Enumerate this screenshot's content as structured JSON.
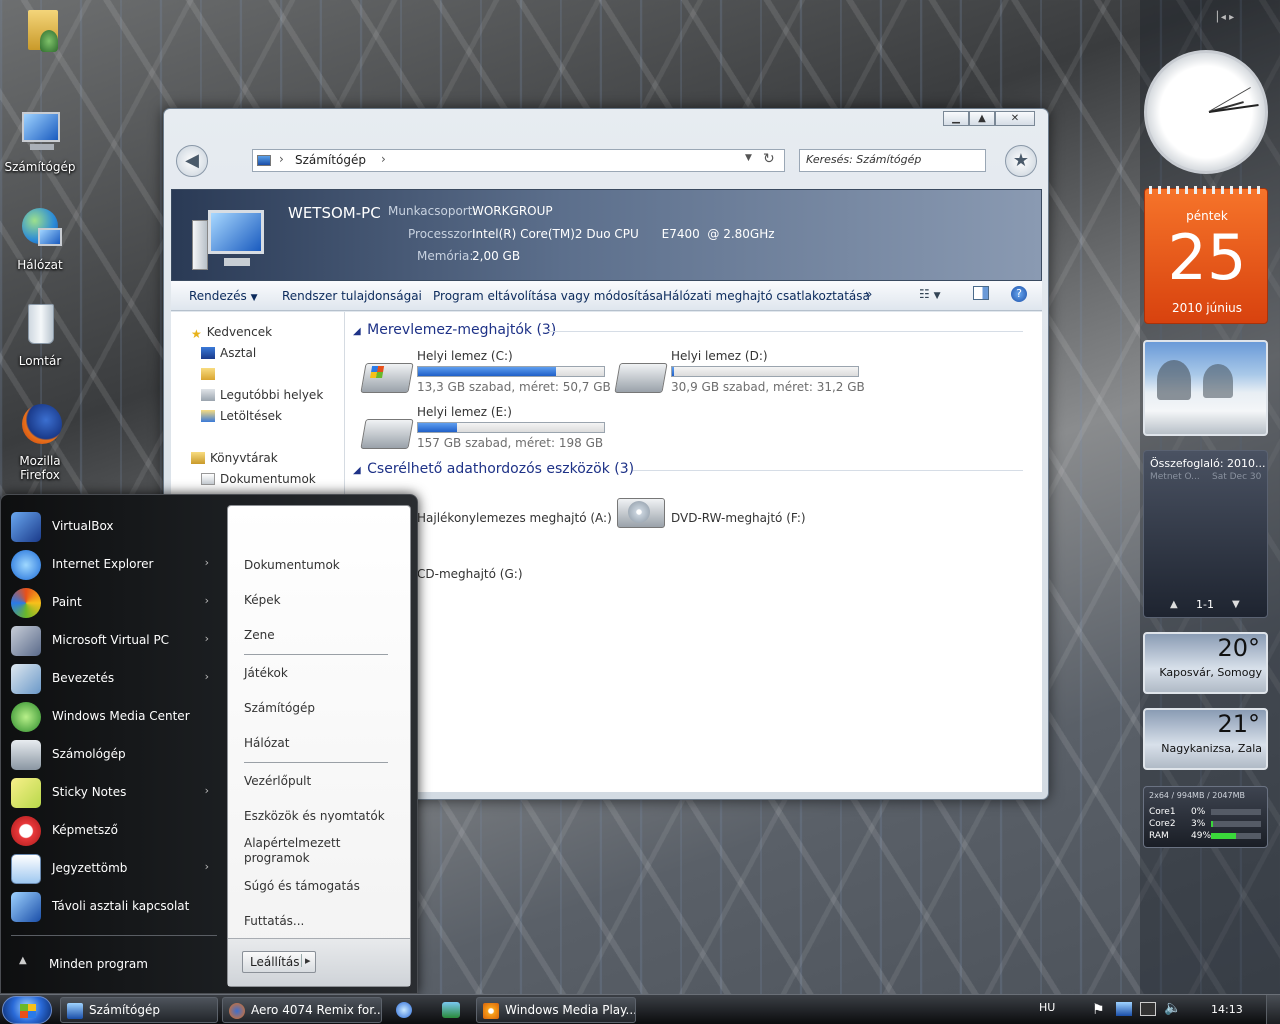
{
  "desktop": {
    "icons": [
      {
        "label": ""
      },
      {
        "label": "Számítógép"
      },
      {
        "label": "Hálózat"
      },
      {
        "label": "Lomtár"
      },
      {
        "label": "Mozilla Firefox"
      }
    ]
  },
  "explorer": {
    "breadcrumb": "Számítógép",
    "search_placeholder": "Keresés: Számítógép",
    "info": {
      "pc_name": "WETSOM-PC",
      "workgroup_label": "Munkacsoport:",
      "workgroup_value": "WORKGROUP",
      "processor_label": "Processzor:",
      "processor_value": "Intel(R) Core(TM)2 Duo CPU      E7400  @ 2.80GHz",
      "memory_label": "Memória:",
      "memory_value": "2,00 GB"
    },
    "commands": {
      "organize": "Rendezés",
      "system_properties": "Rendszer tulajdonságai",
      "uninstall": "Program eltávolítása vagy módosítása",
      "map_drive": "Hálózati meghajtó csatlakoztatása",
      "more": "»"
    },
    "nav": {
      "favorites": "Kedvencek",
      "desktop": "Asztal",
      "unnamed": "",
      "recent": "Legutóbbi helyek",
      "downloads": "Letöltések",
      "libraries": "Könyvtárak",
      "documents": "Dokumentumok"
    },
    "hdd_group": "Merevlemez-meghajtók (3)",
    "drives": [
      {
        "name": "Helyi lemez (C:)",
        "size": "13,3 GB szabad, méret: 50,7 GB",
        "used_fraction": 0.74
      },
      {
        "name": "Helyi lemez (D:)",
        "size": "30,9 GB szabad, méret: 31,2 GB",
        "used_fraction": 0.01
      },
      {
        "name": "Helyi lemez (E:)",
        "size": "157 GB szabad, méret: 198 GB",
        "used_fraction": 0.21
      }
    ],
    "removable_group": "Cserélhető adathordozós eszközök (3)",
    "removable": [
      {
        "name": "Hajlékonylemezes meghajtó (A:)"
      },
      {
        "name": "DVD-RW-meghajtó (F:)"
      },
      {
        "name": "CD-meghajtó (G:)"
      }
    ]
  },
  "start_menu": {
    "programs": [
      {
        "label": "VirtualBox",
        "arrow": ""
      },
      {
        "label": "Internet Explorer",
        "arrow": "›"
      },
      {
        "label": "Paint",
        "arrow": "›"
      },
      {
        "label": "Microsoft Virtual PC",
        "arrow": "›"
      },
      {
        "label": "Bevezetés",
        "arrow": "›"
      },
      {
        "label": "Windows Media Center",
        "arrow": ""
      },
      {
        "label": "Számológép",
        "arrow": ""
      },
      {
        "label": "Sticky Notes",
        "arrow": "›"
      },
      {
        "label": "Képmetsző",
        "arrow": ""
      },
      {
        "label": "Jegyzettömb",
        "arrow": "›"
      },
      {
        "label": "Távoli asztali kapcsolat",
        "arrow": ""
      }
    ],
    "all_programs": "Minden program",
    "right": {
      "user": "",
      "documents": "Dokumentumok",
      "pictures": "Képek",
      "music": "Zene",
      "games": "Játékok",
      "computer": "Számítógép",
      "network": "Hálózat",
      "control_panel": "Vezérlőpult",
      "devices": "Eszközök és nyomtatók",
      "default_programs": "Alapértelmezett programok",
      "help": "Súgó és támogatás",
      "run": "Futtatás..."
    },
    "shutdown": "Leállítás",
    "shutdown_arrow": "▸"
  },
  "gadgets": {
    "calendar": {
      "day_name": "péntek",
      "day": "25",
      "month_year": "2010 június"
    },
    "feed": {
      "title": "Összefoglaló: 2010...",
      "source": "Metnet O...",
      "date": "Sat Dec 30",
      "pager": "1-1"
    },
    "weather": [
      {
        "temp": "20°",
        "city": "Kaposvár, Somogy"
      },
      {
        "temp": "21°",
        "city": "Nagykanizsa, Zala"
      }
    ],
    "cpu": {
      "header": "2x64 / 994MB / 2047MB",
      "rows": [
        {
          "label": "Core1",
          "value": "0%",
          "fraction": 0.0
        },
        {
          "label": "Core2",
          "value": "3%",
          "fraction": 0.03
        },
        {
          "label": "RAM",
          "value": "49%",
          "fraction": 0.49
        }
      ]
    }
  },
  "taskbar": {
    "buttons": [
      {
        "label": "Számítógép"
      },
      {
        "label": "Aero 4074 Remix for..."
      },
      {
        "label": "Windows Media Play..."
      }
    ],
    "language": "HU",
    "time": "14:13"
  },
  "colors": {
    "accent": "#1e3287",
    "calendar": "#e8501a",
    "progress": "#2a6fd6"
  }
}
